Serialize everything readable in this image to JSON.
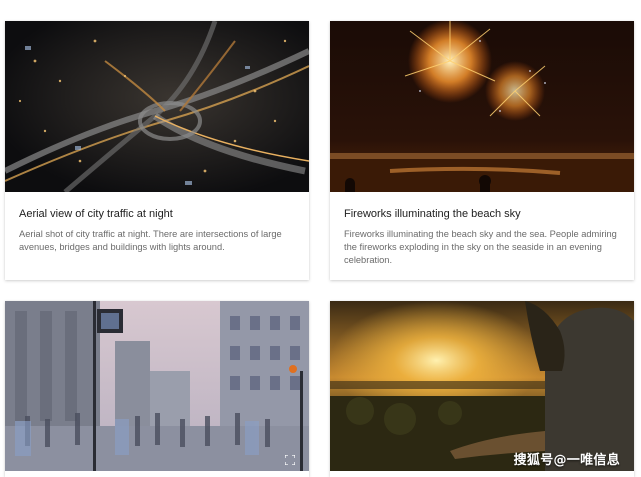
{
  "cards": [
    {
      "title": "Aerial view of city traffic at night",
      "description": "Aerial shot of city traffic at night. There are intersections of large avenues, bridges and buildings with lights around."
    },
    {
      "title": "Fireworks illuminating the beach sky",
      "description": "Fireworks illuminating the beach sky and the sea. People admiring the fireworks exploding in the sky on the seaside in an evening celebration."
    },
    {
      "title": "",
      "description": ""
    },
    {
      "title": "",
      "description": ""
    }
  ],
  "icons": {
    "expand": "expand-icon"
  },
  "watermark": {
    "text": "搜狐号@一唯信息"
  },
  "colors": {
    "title": "#212121",
    "description": "#6b6b6b"
  }
}
